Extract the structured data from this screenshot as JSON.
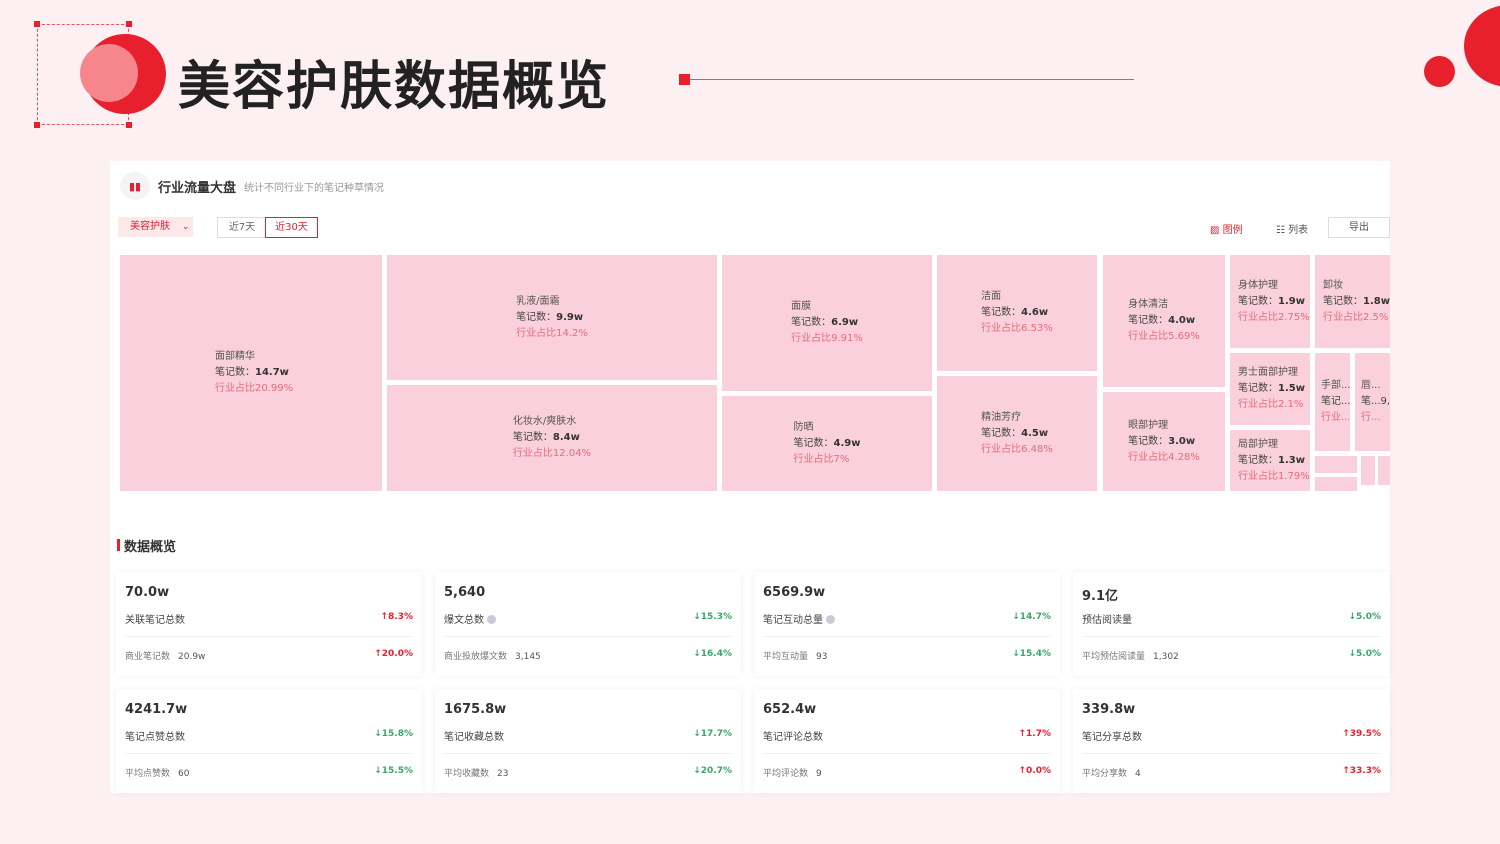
{
  "slide": {
    "title": "美容护肤数据概览"
  },
  "panel": {
    "title": "行业流量大盘",
    "subtitle": "统计不同行业下的笔记种草情况",
    "category_select": "美容护肤",
    "range_7": "近7天",
    "range_30": "近30天",
    "tool_chart": "图例",
    "tool_list": "列表",
    "tool_export": "导出"
  },
  "treemap": [
    {
      "name": "面部精华",
      "count": "笔记数：",
      "count_val": "14.7w",
      "pct": "行业占比20.99%"
    },
    {
      "name": "乳液/面霜",
      "count": "笔记数：",
      "count_val": "9.9w",
      "pct": "行业占比14.2%"
    },
    {
      "name": "化妆水/爽肤水",
      "count": "笔记数：",
      "count_val": "8.4w",
      "pct": "行业占比12.04%"
    },
    {
      "name": "面膜",
      "count": "笔记数：",
      "count_val": "6.9w",
      "pct": "行业占比9.91%"
    },
    {
      "name": "防晒",
      "count": "笔记数：",
      "count_val": "4.9w",
      "pct": "行业占比7%"
    },
    {
      "name": "洁面",
      "count": "笔记数：",
      "count_val": "4.6w",
      "pct": "行业占比6.53%"
    },
    {
      "name": "精油芳疗",
      "count": "笔记数：",
      "count_val": "4.5w",
      "pct": "行业占比6.48%"
    },
    {
      "name": "身体清洁",
      "count": "笔记数：",
      "count_val": "4.0w",
      "pct": "行业占比5.69%"
    },
    {
      "name": "眼部护理",
      "count": "笔记数：",
      "count_val": "3.0w",
      "pct": "行业占比4.28%"
    },
    {
      "name": "身体护理",
      "count": "笔记数：",
      "count_val": "1.9w",
      "pct": "行业占比2.75%"
    },
    {
      "name": "卸妆",
      "count": "笔记数：",
      "count_val": "1.8w",
      "pct": "行业占比2.5%"
    },
    {
      "name": "男士面部护理",
      "count": "笔记数：",
      "count_val": "1.5w",
      "pct": "行业占比2.1%"
    },
    {
      "name": "局部护理",
      "count": "笔记数：",
      "count_val": "1.3w",
      "pct": "行业占比1.79%"
    },
    {
      "name": "手部...",
      "count": "笔记...",
      "count_val": "",
      "pct": "行业..."
    },
    {
      "name": "唇...",
      "count": "笔...9,",
      "count_val": "",
      "pct": "行..."
    }
  ],
  "overview": {
    "title": "数据概览",
    "cards": [
      {
        "value": "70.0w",
        "label": "关联笔记总数",
        "change": "↑8.3%",
        "sub_label": "商业笔记数",
        "sub_value": "20.9w",
        "sub_change": "↑20.0%"
      },
      {
        "value": "5,640",
        "label": "爆文总数",
        "change": "↓15.3%",
        "sub_label": "商业投放爆文数",
        "sub_value": "3,145",
        "sub_change": "↓16.4%"
      },
      {
        "value": "6569.9w",
        "label": "笔记互动总量",
        "change": "↓14.7%",
        "sub_label": "平均互动量",
        "sub_value": "93",
        "sub_change": "↓15.4%"
      },
      {
        "value": "9.1亿",
        "label": "预估阅读量",
        "change": "↓5.0%",
        "sub_label": "平均预估阅读量",
        "sub_value": "1,302",
        "sub_change": "↓5.0%"
      },
      {
        "value": "4241.7w",
        "label": "笔记点赞总数",
        "change": "↓15.8%",
        "sub_label": "平均点赞数",
        "sub_value": "60",
        "sub_change": "↓15.5%"
      },
      {
        "value": "1675.8w",
        "label": "笔记收藏总数",
        "change": "↓17.7%",
        "sub_label": "平均收藏数",
        "sub_value": "23",
        "sub_change": "↓20.7%"
      },
      {
        "value": "652.4w",
        "label": "笔记评论总数",
        "change": "↑1.7%",
        "sub_label": "平均评论数",
        "sub_value": "9",
        "sub_change": "↑0.0%"
      },
      {
        "value": "339.8w",
        "label": "笔记分享总数",
        "change": "↑39.5%",
        "sub_label": "平均分享数",
        "sub_value": "4",
        "sub_change": "↑33.3%"
      }
    ]
  },
  "colors": {
    "accent": "#e8202e",
    "tile": "#f9d0dc",
    "up": "#e8202e",
    "down": "#3aa66b"
  }
}
